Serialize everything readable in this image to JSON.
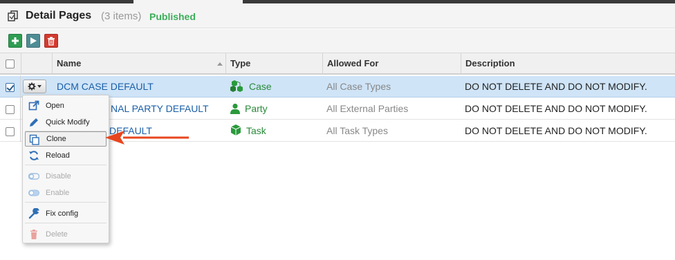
{
  "header": {
    "title": "Detail Pages",
    "count": "(3 items)",
    "status": "Published",
    "status_color": "#3cae5a",
    "icon": "pages-icon"
  },
  "toolbar": {
    "buttons": [
      {
        "name": "add-button",
        "icon": "plus-icon",
        "color": "#2e9d52"
      },
      {
        "name": "run-button",
        "icon": "play-icon",
        "color": "#4e8d95"
      },
      {
        "name": "delete-button",
        "icon": "trash-icon",
        "color": "#d43a2f"
      }
    ]
  },
  "table": {
    "columns": [
      "Name",
      "Type",
      "Allowed For",
      "Description"
    ],
    "rows": [
      {
        "checked": true,
        "name": "DCM CASE DEFAULT",
        "type": "Case",
        "type_icon": "cubes-icon",
        "allowed": "All Case Types",
        "description": "DO NOT DELETE AND DO NOT MODIFY."
      },
      {
        "checked": false,
        "name": "DCM EXTERNAL PARTY DEFAULT",
        "type": "Party",
        "type_icon": "user-icon",
        "allowed": "All External Parties",
        "description": "DO NOT DELETE AND DO NOT MODIFY."
      },
      {
        "checked": false,
        "name": "DCM TASK DEFAULT",
        "type": "Task",
        "type_icon": "cube-icon",
        "allowed": "All Task Types",
        "description": "DO NOT DELETE AND DO NOT MODIFY."
      }
    ],
    "visible_name_fragments": [
      "DCM CASE DEFAULT",
      "NAL PARTY DEFAULT",
      "DEFAULT"
    ]
  },
  "context_menu": {
    "items": [
      {
        "label": "Open",
        "icon": "external-link-icon",
        "disabled": false
      },
      {
        "label": "Quick Modify",
        "icon": "pencil-icon",
        "disabled": false
      },
      {
        "label": "Clone",
        "icon": "copy-icon",
        "disabled": false,
        "highlighted": true
      },
      {
        "label": "Reload",
        "icon": "refresh-icon",
        "disabled": false
      },
      {
        "label": "Disable",
        "icon": "toggle-off-icon",
        "disabled": true
      },
      {
        "label": "Enable",
        "icon": "toggle-on-icon",
        "disabled": true
      },
      {
        "label": "Fix config",
        "icon": "wrench-icon",
        "disabled": false
      },
      {
        "label": "Delete",
        "icon": "trash-icon",
        "disabled": true
      }
    ]
  },
  "annotation": {
    "arrow_color": "#e8461e",
    "points_to": "Clone"
  },
  "colors": {
    "selected_row": "#cfe4f7",
    "link": "#1a5fa8",
    "type_green": "#2a8a3a"
  }
}
